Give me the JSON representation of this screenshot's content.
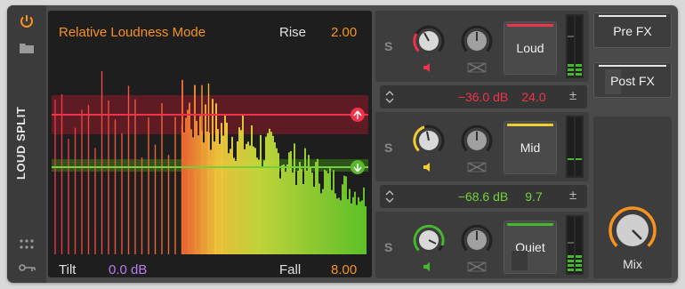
{
  "device": {
    "title": "LOUD SPLIT",
    "icons": {
      "power": "power-icon",
      "folder": "folder-icon",
      "grid": "grid-icon",
      "key": "key-icon"
    }
  },
  "display": {
    "mode": "Relative Loudness Mode",
    "rise_label": "Rise",
    "rise_value": "2.00",
    "tilt_label": "Tilt",
    "tilt_value": "0.0 dB",
    "fall_label": "Fall",
    "fall_value": "8.00"
  },
  "bands": [
    {
      "name": "Loud",
      "solo": "S",
      "color": "#f0334a"
    },
    {
      "name": "Mid",
      "solo": "S",
      "color": "#f2cd2f"
    },
    {
      "name": "Quiet",
      "solo": "S",
      "color": "#46b82e"
    }
  ],
  "thresholds": [
    {
      "db": "−36.0 dB",
      "ratio": "24.0",
      "color": "#f0334a",
      "pm": "±"
    },
    {
      "db": "−68.6 dB",
      "ratio": "9.7",
      "color": "#73d03a",
      "pm": "±"
    }
  ],
  "fx": {
    "pre": "Pre FX",
    "post": "Post FX"
  },
  "mix": {
    "label": "Mix"
  },
  "colors": {
    "accent": "#f7921e",
    "tilt": "#b77cf0"
  }
}
